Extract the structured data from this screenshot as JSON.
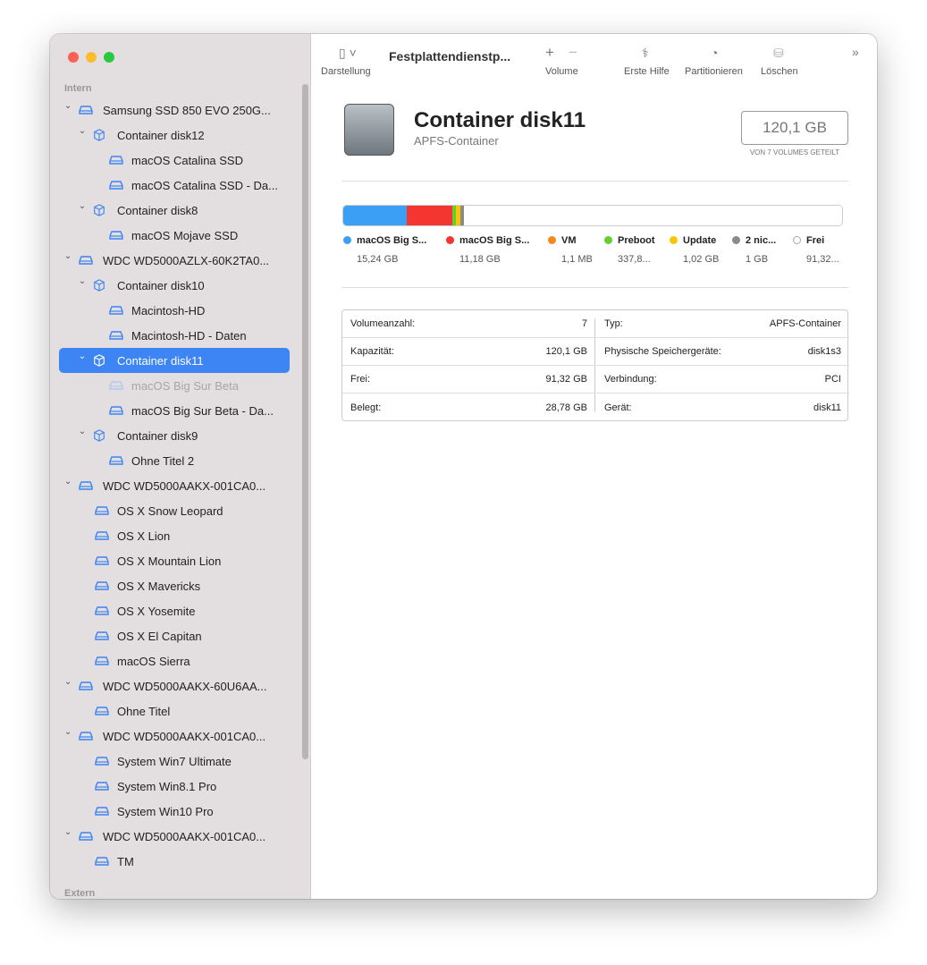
{
  "sidebar": {
    "section_intern": "Intern",
    "section_extern": "Extern",
    "items": [
      {
        "label": "Samsung SSD 850 EVO 250G...",
        "level": 0,
        "type": "disk",
        "chevron": true
      },
      {
        "label": "Container disk12",
        "level": 1,
        "type": "container",
        "chevron": true
      },
      {
        "label": "macOS Catalina SSD",
        "level": 2,
        "type": "volume"
      },
      {
        "label": "macOS Catalina SSD - Da...",
        "level": 2,
        "type": "volume"
      },
      {
        "label": "Container disk8",
        "level": 1,
        "type": "container",
        "chevron": true
      },
      {
        "label": "macOS Mojave SSD",
        "level": 2,
        "type": "volume"
      },
      {
        "label": "WDC WD5000AZLX-60K2TA0...",
        "level": 0,
        "type": "disk",
        "chevron": true
      },
      {
        "label": "Container disk10",
        "level": 1,
        "type": "container",
        "chevron": true
      },
      {
        "label": "Macintosh-HD",
        "level": 2,
        "type": "volume"
      },
      {
        "label": "Macintosh-HD - Daten",
        "level": 2,
        "type": "volume"
      },
      {
        "label": "Container disk11",
        "level": 1,
        "type": "container",
        "chevron": true,
        "selected": true
      },
      {
        "label": "macOS Big Sur Beta",
        "level": 2,
        "type": "volume",
        "dimmed": true
      },
      {
        "label": "macOS Big Sur Beta - Da...",
        "level": 2,
        "type": "volume"
      },
      {
        "label": "Container disk9",
        "level": 1,
        "type": "container",
        "chevron": true
      },
      {
        "label": "Ohne Titel 2",
        "level": 2,
        "type": "volume"
      },
      {
        "label": "WDC WD5000AAKX-001CA0...",
        "level": 0,
        "type": "disk",
        "chevron": true
      },
      {
        "label": "OS X Snow Leopard",
        "level": 1,
        "type": "volume"
      },
      {
        "label": "OS X Lion",
        "level": 1,
        "type": "volume"
      },
      {
        "label": "OS X Mountain Lion",
        "level": 1,
        "type": "volume"
      },
      {
        "label": "OS X Mavericks",
        "level": 1,
        "type": "volume"
      },
      {
        "label": "OS X Yosemite",
        "level": 1,
        "type": "volume"
      },
      {
        "label": "OS X El Capitan",
        "level": 1,
        "type": "volume"
      },
      {
        "label": "macOS Sierra",
        "level": 1,
        "type": "volume"
      },
      {
        "label": "WDC WD5000AAKX-60U6AA...",
        "level": 0,
        "type": "disk",
        "chevron": true
      },
      {
        "label": "Ohne Titel",
        "level": 1,
        "type": "volume"
      },
      {
        "label": "WDC WD5000AAKX-001CA0...",
        "level": 0,
        "type": "disk",
        "chevron": true
      },
      {
        "label": "System Win7 Ultimate",
        "level": 1,
        "type": "volume"
      },
      {
        "label": "System Win8.1 Pro",
        "level": 1,
        "type": "volume"
      },
      {
        "label": "System Win10 Pro",
        "level": 1,
        "type": "volume"
      },
      {
        "label": "WDC WD5000AAKX-001CA0...",
        "level": 0,
        "type": "disk",
        "chevron": true
      },
      {
        "label": "TM",
        "level": 1,
        "type": "volume"
      }
    ]
  },
  "toolbar": {
    "view": "Darstellung",
    "title": "Festplattendienstp...",
    "volume": "Volume",
    "first_aid": "Erste Hilfe",
    "partition": "Partitionieren",
    "erase": "Löschen"
  },
  "header": {
    "name": "Container disk11",
    "type": "APFS-Container",
    "capacity": "120,1 GB",
    "shared": "VON 7 VOLUMES GETEILT"
  },
  "usage": [
    {
      "name": "macOS Big S...",
      "value": "15,24 GB",
      "color": "#3a9ff5",
      "gb": 15.24
    },
    {
      "name": "macOS Big S...",
      "value": "11,18 GB",
      "color": "#f53530",
      "gb": 11.18
    },
    {
      "name": "VM",
      "value": "1,1 MB",
      "color": "#f5891e",
      "gb": 0.0011
    },
    {
      "name": "Preboot",
      "value": "337,8...",
      "color": "#62d02e",
      "gb": 0.34
    },
    {
      "name": "Update",
      "value": "1,02 GB",
      "color": "#f7c600",
      "gb": 1.02
    },
    {
      "name": "2 nic...",
      "value": "1 GB",
      "color": "#8a8a8a",
      "gb": 1.0
    },
    {
      "name": "Frei",
      "value": "91,32...",
      "color": "#ffffff",
      "gb": 91.32
    }
  ],
  "details": {
    "left": [
      [
        "Volumeanzahl:",
        "7"
      ],
      [
        "Kapazität:",
        "120,1 GB"
      ],
      [
        "Frei:",
        "91,32 GB"
      ],
      [
        "Belegt:",
        "28,78 GB"
      ]
    ],
    "right": [
      [
        "Typ:",
        "APFS-Container"
      ],
      [
        "Physische Speichergeräte:",
        "disk1s3"
      ],
      [
        "Verbindung:",
        "PCI"
      ],
      [
        "Gerät:",
        "disk11"
      ]
    ]
  }
}
